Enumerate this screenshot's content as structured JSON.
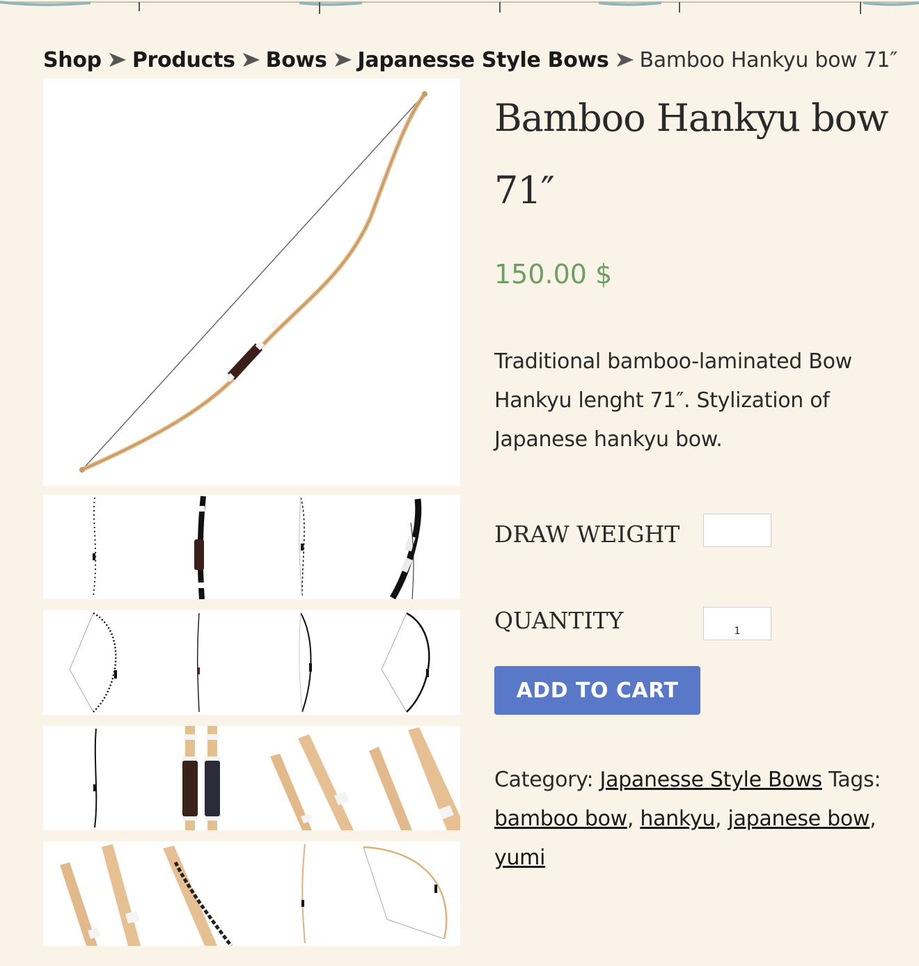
{
  "breadcrumb": {
    "items": [
      "Shop",
      "Products",
      "Bows",
      "Japanesse Style Bows"
    ],
    "current": "Bamboo Hankyu bow 71″"
  },
  "product": {
    "title": "Bamboo Hankyu bow 71″",
    "price": "150.00 $",
    "description": "Traditional bamboo-laminated Bow Hankyu lenght 71″. Stylization of Japanese hankyu bow."
  },
  "options": {
    "draw_weight_label": "DRAW WEIGHT",
    "draw_weight_value": "",
    "quantity_label": "QUANTITY",
    "quantity_value": "1"
  },
  "actions": {
    "add_to_cart": "ADD TO CART"
  },
  "meta": {
    "category_label": "Category:",
    "category": "Japanesse Style Bows",
    "tags_label": "Tags:",
    "tags": [
      "bamboo bow",
      "hankyu",
      "japanese bow",
      "yumi"
    ]
  },
  "colors": {
    "background": "#f9f3e8",
    "price": "#6fa063",
    "button": "#5a78c8",
    "bamboo": "#dfb27c"
  }
}
